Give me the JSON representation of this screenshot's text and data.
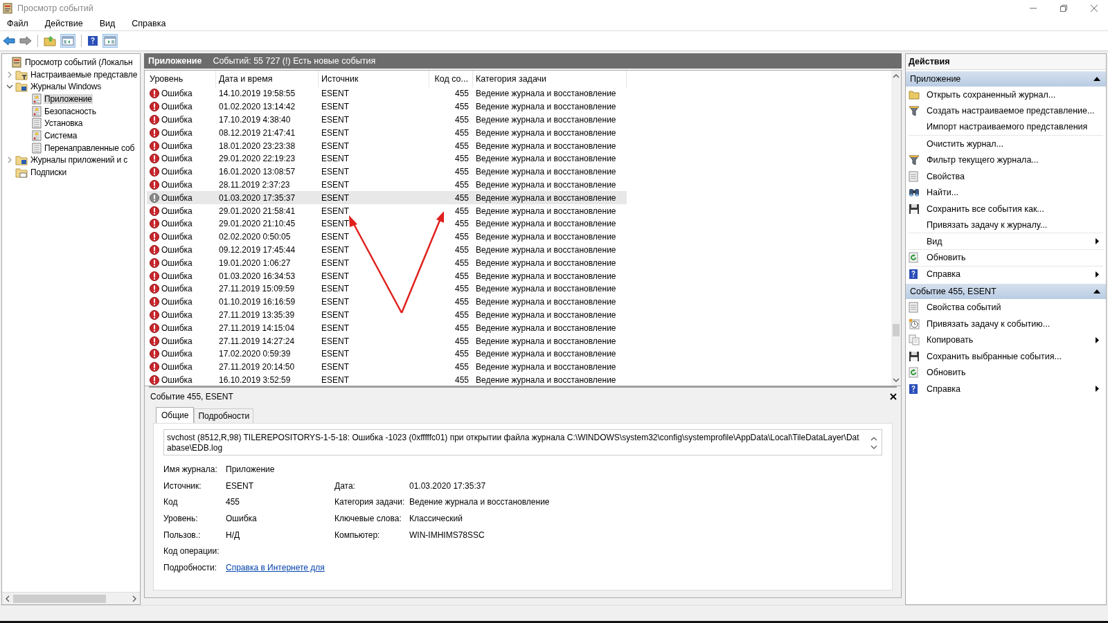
{
  "window": {
    "title": "Просмотр событий"
  },
  "menu": [
    "Файл",
    "Действие",
    "Вид",
    "Справка"
  ],
  "tree": [
    {
      "label": "Просмотр событий (Локальн",
      "kind": "root",
      "selected": false,
      "children": [
        {
          "label": "Настраиваемые представле",
          "kind": "filter-folder",
          "expanded": false,
          "selected": false
        },
        {
          "label": "Журналы Windows",
          "kind": "folder",
          "expanded": true,
          "selected": false,
          "children": [
            {
              "label": "Приложение",
              "kind": "log",
              "selected": true
            },
            {
              "label": "Безопасность",
              "kind": "log",
              "selected": false
            },
            {
              "label": "Установка",
              "kind": "plain-log",
              "selected": false
            },
            {
              "label": "Система",
              "kind": "log",
              "selected": false
            },
            {
              "label": "Перенаправленные соб",
              "kind": "plain-log",
              "selected": false
            }
          ]
        },
        {
          "label": "Журналы приложений и с",
          "kind": "folder",
          "expanded": false,
          "selected": false
        },
        {
          "label": "Подписки",
          "kind": "sub-folder",
          "selected": false
        }
      ]
    }
  ],
  "header": {
    "title": "Приложение",
    "info": "Событий: 55 727 (!) Есть новые события"
  },
  "table": {
    "columns": [
      "Уровень",
      "Дата и время",
      "Источник",
      "Код со...",
      "Категория задачи"
    ],
    "rows": [
      {
        "level": "Ошибка",
        "date": "14.10.2019 19:58:55",
        "source": "ESENT",
        "code": "455",
        "category": "Ведение журнала и восстановление",
        "selected": false
      },
      {
        "level": "Ошибка",
        "date": "01.02.2020 13:14:42",
        "source": "ESENT",
        "code": "455",
        "category": "Ведение журнала и восстановление",
        "selected": false
      },
      {
        "level": "Ошибка",
        "date": "17.10.2019 4:38:40",
        "source": "ESENT",
        "code": "455",
        "category": "Ведение журнала и восстановление",
        "selected": false
      },
      {
        "level": "Ошибка",
        "date": "08.12.2019 21:47:41",
        "source": "ESENT",
        "code": "455",
        "category": "Ведение журнала и восстановление",
        "selected": false
      },
      {
        "level": "Ошибка",
        "date": "18.01.2020 23:23:38",
        "source": "ESENT",
        "code": "455",
        "category": "Ведение журнала и восстановление",
        "selected": false
      },
      {
        "level": "Ошибка",
        "date": "29.01.2020 22:19:23",
        "source": "ESENT",
        "code": "455",
        "category": "Ведение журнала и восстановление",
        "selected": false
      },
      {
        "level": "Ошибка",
        "date": "16.01.2020 13:08:57",
        "source": "ESENT",
        "code": "455",
        "category": "Ведение журнала и восстановление",
        "selected": false
      },
      {
        "level": "Ошибка",
        "date": "28.11.2019 2:37:23",
        "source": "ESENT",
        "code": "455",
        "category": "Ведение журнала и восстановление",
        "selected": false
      },
      {
        "level": "Ошибка",
        "date": "01.03.2020 17:35:37",
        "source": "ESENT",
        "code": "455",
        "category": "Ведение журнала и восстановление",
        "selected": true
      },
      {
        "level": "Ошибка",
        "date": "29.01.2020 21:58:41",
        "source": "ESENT",
        "code": "455",
        "category": "Ведение журнала и восстановление",
        "selected": false
      },
      {
        "level": "Ошибка",
        "date": "29.01.2020 21:10:45",
        "source": "ESENT",
        "code": "455",
        "category": "Ведение журнала и восстановление",
        "selected": false
      },
      {
        "level": "Ошибка",
        "date": "02.02.2020 0:50:05",
        "source": "ESENT",
        "code": "455",
        "category": "Ведение журнала и восстановление",
        "selected": false
      },
      {
        "level": "Ошибка",
        "date": "09.12.2019 17:45:44",
        "source": "ESENT",
        "code": "455",
        "category": "Ведение журнала и восстановление",
        "selected": false
      },
      {
        "level": "Ошибка",
        "date": "19.01.2020 1:06:27",
        "source": "ESENT",
        "code": "455",
        "category": "Ведение журнала и восстановление",
        "selected": false
      },
      {
        "level": "Ошибка",
        "date": "01.03.2020 16:34:53",
        "source": "ESENT",
        "code": "455",
        "category": "Ведение журнала и восстановление",
        "selected": false
      },
      {
        "level": "Ошибка",
        "date": "27.11.2019 15:09:59",
        "source": "ESENT",
        "code": "455",
        "category": "Ведение журнала и восстановление",
        "selected": false
      },
      {
        "level": "Ошибка",
        "date": "01.10.2019 16:16:59",
        "source": "ESENT",
        "code": "455",
        "category": "Ведение журнала и восстановление",
        "selected": false
      },
      {
        "level": "Ошибка",
        "date": "27.11.2019 13:35:39",
        "source": "ESENT",
        "code": "455",
        "category": "Ведение журнала и восстановление",
        "selected": false
      },
      {
        "level": "Ошибка",
        "date": "27.11.2019 14:15:04",
        "source": "ESENT",
        "code": "455",
        "category": "Ведение журнала и восстановление",
        "selected": false
      },
      {
        "level": "Ошибка",
        "date": "27.11.2019 14:27:24",
        "source": "ESENT",
        "code": "455",
        "category": "Ведение журнала и восстановление",
        "selected": false
      },
      {
        "level": "Ошибка",
        "date": "17.02.2020 0:59:39",
        "source": "ESENT",
        "code": "455",
        "category": "Ведение журнала и восстановление",
        "selected": false
      },
      {
        "level": "Ошибка",
        "date": "27.11.2019 20:14:50",
        "source": "ESENT",
        "code": "455",
        "category": "Ведение журнала и восстановление",
        "selected": false
      },
      {
        "level": "Ошибка",
        "date": "16.10.2019 3:52:59",
        "source": "ESENT",
        "code": "455",
        "category": "Ведение журнала и восстановление",
        "selected": false
      }
    ]
  },
  "detail": {
    "title": "Событие 455, ESENT",
    "tabs": [
      {
        "label": "Общие",
        "selected": true
      },
      {
        "label": "Подробности",
        "selected": false
      }
    ],
    "description": "svchost (8512,R,98) TILEREPOSITORYS-1-5-18: Ошибка -1023 (0xfffffc01) при открытии файла журнала C:\\WINDOWS\\system32\\config\\systemprofile\\AppData\\Local\\TileDataLayer\\Database\\EDB.log",
    "fields": [
      {
        "label": "Имя журнала:",
        "value": "Приложение"
      },
      {
        "label": "Источник:",
        "value": "ESENT",
        "right": {
          "label": "Дата:",
          "value": "01.03.2020 17:35:37"
        }
      },
      {
        "label": "Код",
        "value": "455",
        "right": {
          "label": "Категория задачи:",
          "value": "Ведение журнала и восстановление"
        }
      },
      {
        "label": "Уровень:",
        "value": "Ошибка",
        "right": {
          "label": "Ключевые слова:",
          "value": "Классический"
        }
      },
      {
        "label": "Пользов.:",
        "value": "Н/Д",
        "right": {
          "label": "Компьютер:",
          "value": "WIN-IMHIMS78SSC"
        }
      },
      {
        "label": "Код операции:"
      },
      {
        "label": "Подробности:",
        "value": "Справка в Интернете для",
        "kind": "link"
      }
    ]
  },
  "actions": {
    "title": "Действия",
    "sections": [
      {
        "title": "Приложение",
        "expanded": true,
        "items": [
          {
            "label": "Открыть сохраненный журнал...",
            "submenu": false
          },
          {
            "label": "Создать настраиваемое представление...",
            "submenu": false
          },
          {
            "label": "Импорт настраиваемого представления",
            "submenu": false
          },
          {
            "label": "Очистить журнал...",
            "submenu": false
          },
          {
            "label": "Фильтр текущего журнала...",
            "submenu": false
          },
          {
            "label": "Свойства",
            "submenu": false
          },
          {
            "label": "Найти...",
            "submenu": false
          },
          {
            "label": "Сохранить все события как...",
            "submenu": false
          },
          {
            "label": "Привязать задачу к журналу...",
            "submenu": false
          },
          {
            "label": "Вид",
            "submenu": true
          },
          {
            "label": "Обновить",
            "submenu": false
          },
          {
            "label": "Справка",
            "submenu": true
          }
        ]
      },
      {
        "title": "Событие 455, ESENT",
        "expanded": true,
        "items": [
          {
            "label": "Свойства событий",
            "submenu": false
          },
          {
            "label": "Привязать задачу к событию...",
            "submenu": false
          },
          {
            "label": "Копировать",
            "submenu": true
          },
          {
            "label": "Сохранить выбранные события...",
            "submenu": false
          },
          {
            "label": "Обновить",
            "submenu": false
          },
          {
            "label": "Справка",
            "submenu": true
          }
        ]
      }
    ]
  }
}
